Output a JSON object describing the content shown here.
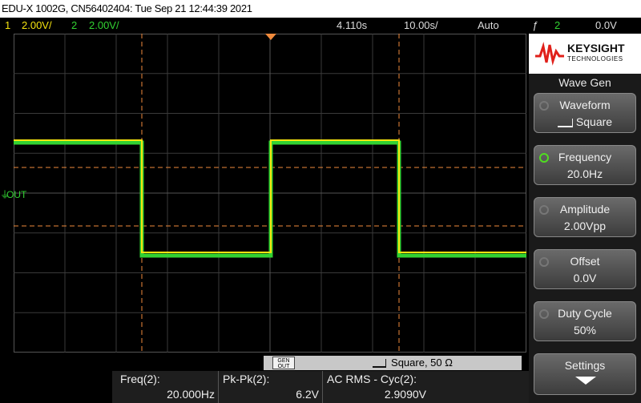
{
  "titlebar": {
    "text": "EDU-X 1002G, CN56402404: Tue Sep 21 12:44:39 2021"
  },
  "statusbar": {
    "ch1_num": "1",
    "ch1_scale": "2.00V/",
    "ch2_num": "2",
    "ch2_scale": "2.00V/",
    "time_offset": "4.110s",
    "time_scale": "10.00s/",
    "trigger_mode": "Auto",
    "trigger_symbol": "ƒ",
    "trigger_channel": "2",
    "trigger_level": "0.0V"
  },
  "screen": {
    "out_label": "OUT",
    "ground_marker": "1"
  },
  "logo": {
    "name": "KEYSIGHT",
    "sub": "TECHNOLOGIES"
  },
  "panel": {
    "title": "Wave Gen",
    "softkeys": [
      {
        "label": "Waveform",
        "value": "Square",
        "active": false
      },
      {
        "label": "Frequency",
        "value": "20.0Hz",
        "active": true
      },
      {
        "label": "Amplitude",
        "value": "2.00Vpp",
        "active": false
      },
      {
        "label": "Offset",
        "value": "0.0V",
        "active": false
      },
      {
        "label": "Duty Cycle",
        "value": "50%",
        "active": false
      },
      {
        "label": "Settings",
        "value": "",
        "active": false
      }
    ]
  },
  "genbar": {
    "badge_top": "GEN",
    "badge_bottom": "OUT",
    "label": "Square, 50 Ω"
  },
  "measurements": [
    {
      "label": "Freq(2):",
      "value": "20.000Hz"
    },
    {
      "label": "Pk-Pk(2):",
      "value": "6.2V"
    },
    {
      "label": "AC RMS - Cyc(2):",
      "value": "2.9090V"
    }
  ],
  "colors": {
    "ch1": "#f5e30f",
    "ch2": "#32d232",
    "cursor": "#f08a3c",
    "accent_on": "#4fdd20"
  }
}
